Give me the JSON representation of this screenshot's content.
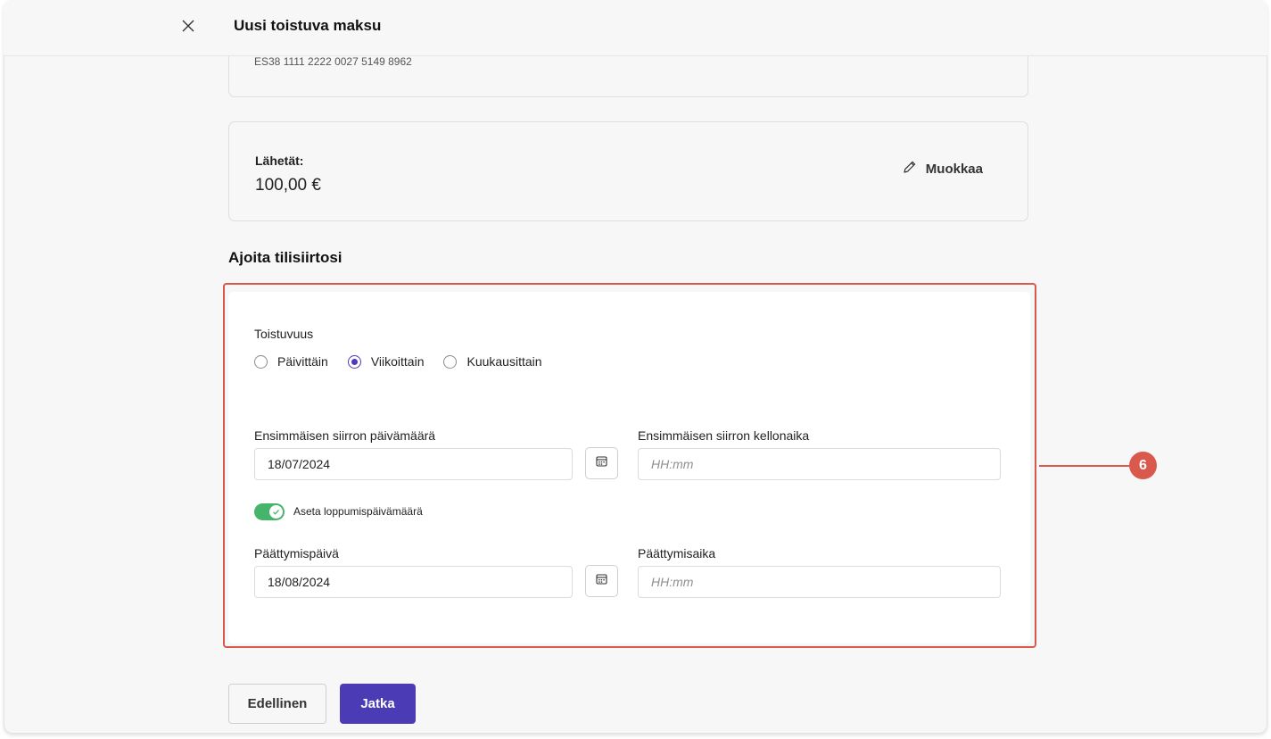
{
  "header": {
    "title": "Uusi toistuva maksu",
    "close_icon": "close-icon"
  },
  "account": {
    "iban": "ES38 1111 2222 0027 5149 8962"
  },
  "amount": {
    "label": "Lähetät:",
    "value": "100,00 €",
    "edit_label": "Muokkaa",
    "edit_icon": "pencil-icon"
  },
  "schedule": {
    "section_title": "Ajoita tilisiirtosi",
    "frequency_label": "Toistuvuus",
    "frequency_options": [
      {
        "label": "Päivittäin",
        "selected": false
      },
      {
        "label": "Viikoittain",
        "selected": true
      },
      {
        "label": "Kuukausittain",
        "selected": false
      }
    ],
    "first_date_label": "Ensimmäisen siirron päivämäärä",
    "first_date_value": "18/07/2024",
    "first_time_label": "Ensimmäisen siirron kellonaika",
    "first_time_placeholder": "HH:mm",
    "end_toggle_label": "Aseta loppumispäivämäärä",
    "end_toggle_on": true,
    "end_date_label": "Päättymispäivä",
    "end_date_value": "18/08/2024",
    "end_time_label": "Päättymisaika",
    "end_time_placeholder": "HH:mm",
    "calendar_icon": "calendar-icon"
  },
  "annotation": {
    "badge": "6",
    "color": "#d9594c"
  },
  "footer": {
    "prev_label": "Edellinen",
    "next_label": "Jatka"
  },
  "colors": {
    "accent": "#4b3bb5",
    "toggle_on": "#45b56c"
  }
}
